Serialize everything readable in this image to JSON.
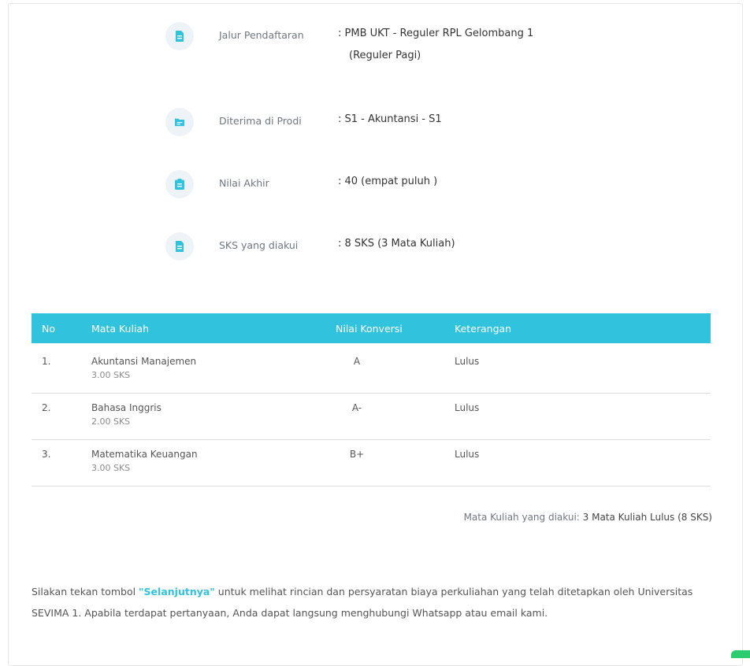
{
  "info": [
    {
      "label": "Jalur Pendaftaran",
      "value_line1": ": PMB UKT - Reguler RPL Gelombang 1",
      "value_line2": "(Reguler Pagi)",
      "icon": "file-icon"
    },
    {
      "label": "Diterima di Prodi",
      "value_line1": ": S1 - Akuntansi - S1",
      "icon": "folder-icon"
    },
    {
      "label": "Nilai Akhir",
      "value_line1": ": 40 (empat puluh )",
      "icon": "clipboard-icon"
    },
    {
      "label": "SKS yang diakui",
      "value_line1": ": 8 SKS (3 Mata Kuliah)",
      "icon": "file-icon"
    }
  ],
  "table": {
    "headers": {
      "no": "No",
      "mata_kuliah": "Mata Kuliah",
      "nilai": "Nilai Konversi",
      "ket": "Keterangan"
    },
    "rows": [
      {
        "no": "1.",
        "name": "Akuntansi Manajemen",
        "sks": "3.00 SKS",
        "grade": "A",
        "ket": "Lulus"
      },
      {
        "no": "2.",
        "name": "Bahasa Inggris",
        "sks": "2.00 SKS",
        "grade": "A-",
        "ket": "Lulus"
      },
      {
        "no": "3.",
        "name": "Matematika Keuangan",
        "sks": "3.00 SKS",
        "grade": "B+",
        "ket": "Lulus"
      }
    ]
  },
  "summary": {
    "prefix": "Mata Kuliah yang diakui: ",
    "value": "3 Mata Kuliah Lulus (8 SKS)"
  },
  "notice": {
    "part1": "Silakan tekan tombol ",
    "highlight": "\"Selanjutnya\"",
    "part2": " untuk melihat rincian dan persyaratan biaya perkuliahan yang telah ditetapkan oleh Universitas SEVIMA 1. Apabila terdapat pertanyaan, Anda dapat langsung menghubungi Whatsapp atau email kami."
  },
  "colors": {
    "accent": "#31c3de",
    "icon_bg": "#eef3f8",
    "icon_fg": "#31c3de"
  }
}
